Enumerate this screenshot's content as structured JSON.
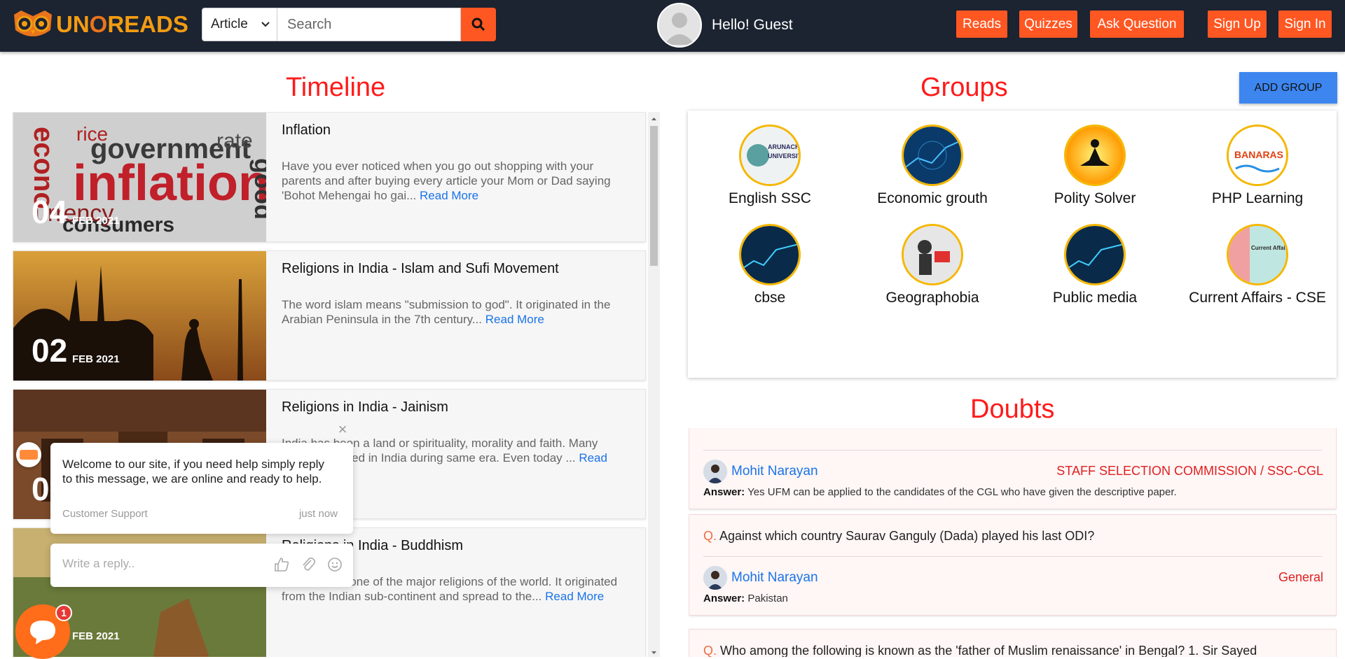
{
  "nav": {
    "logo_text_1": "UN",
    "logo_text_2": "O",
    "logo_text_3": "READS",
    "search_type": "Article",
    "search_placeholder": "Search",
    "greeting": "Hello! Guest",
    "buttons": [
      "Reads",
      "Quizzes",
      "Ask Question",
      "Sign Up",
      "Sign In"
    ]
  },
  "timeline": {
    "heading": "Timeline",
    "read_more": "Read More",
    "posts": [
      {
        "title": "Inflation",
        "day": "04",
        "month": "FEB 2021",
        "excerpt": "Have you ever noticed when you go out shopping with your parents and after buying every article your Mom or Dad saying 'Bohot Mehengai ho gai..."
      },
      {
        "title": "Religions in India - Islam and Sufi Movement",
        "day": "02",
        "month": "FEB 2021",
        "excerpt": "The word islam means \"submission to god\". It originated in the Arabian Peninsula in the 7th century..."
      },
      {
        "title": "Religions in India - Jainism",
        "day": "0",
        "month": "",
        "excerpt": "India has been a land or spirituality, morality and faith. Many religions thrived in India during same era. Even today ..."
      },
      {
        "title": "Religions in India - Buddhism",
        "day": "",
        "month": "FEB 2021",
        "excerpt": "Buddhism is one of the major religions of the world. It originated from the Indian sub-continent and spread to the..."
      }
    ]
  },
  "groups": {
    "heading": "Groups",
    "add_label": "ADD GROUP",
    "items": [
      "English SSC",
      "Economic grouth",
      "Polity Solver",
      "PHP Learning",
      "cbse",
      "Geographobia",
      "Public media",
      "Current Affairs - CSE"
    ]
  },
  "doubts": {
    "heading": "Doubts",
    "answer_label": "Answer:",
    "items": [
      {
        "question": "",
        "user": "Mohit Narayan",
        "category": "STAFF SELECTION COMMISSION / SSC-CGL",
        "answer": "Yes UFM can be applied to the candidates of the CGL who have given the descriptive paper."
      },
      {
        "question": "Against which country Saurav Ganguly (Dada) played his last ODI?",
        "user": "Mohit Narayan",
        "category": "General",
        "answer": "Pakistan"
      },
      {
        "question": "Who among the following is known as the 'father of Muslim renaissance' in Bengal? 1. Sir Sayed",
        "user": "",
        "category": "",
        "answer": ""
      }
    ],
    "q_marker": "Q."
  },
  "chat": {
    "message": "Welcome to our site, if you need help simply reply to this message, we are online and ready to help.",
    "from": "Customer Support",
    "time": "just now",
    "reply_placeholder": "Write a reply..",
    "badge": "1"
  },
  "colors": {
    "nav_bg": "#1c2331",
    "accent": "#ff5722",
    "heading": "#ff1a1a",
    "link": "#1a73e8",
    "group_border": "#f5b700",
    "add_group": "#3d86f0"
  }
}
